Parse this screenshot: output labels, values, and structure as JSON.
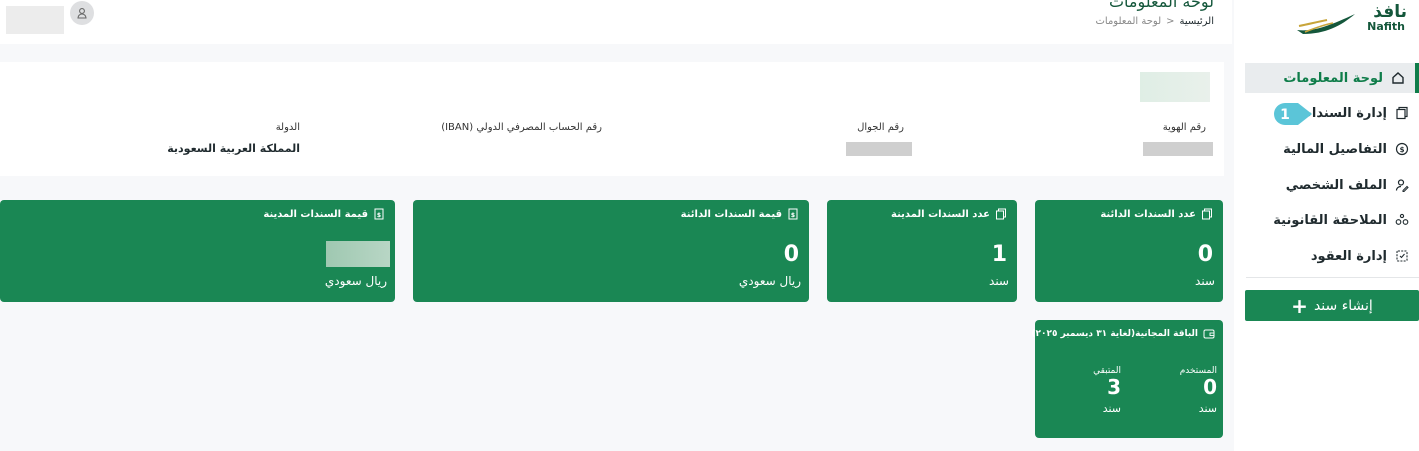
{
  "header": {
    "page_title": "لوحة المعلومات",
    "breadcrumb_home": "الرئيسية",
    "breadcrumb_sep": ">",
    "breadcrumb_current": "لوحة المعلومات"
  },
  "logo": {
    "arabic": "نافذ",
    "latin": "Nafith"
  },
  "sidebar": {
    "items": [
      {
        "label": "لوحة المعلومات",
        "icon": "home-icon"
      },
      {
        "label": "إدارة السندات",
        "icon": "documents-icon"
      },
      {
        "label": "التفاصيل المالية",
        "icon": "currency-icon"
      },
      {
        "label": "الملف الشخصي",
        "icon": "user-edit-icon"
      },
      {
        "label": "الملاحقة القانونية",
        "icon": "legal-icon"
      },
      {
        "label": "إدارة العقود",
        "icon": "contract-icon"
      }
    ],
    "badge": "1",
    "create_label": "إنشاء سند"
  },
  "info": {
    "id_label": "رقم الهوية",
    "mobile_label": "رقم الجوال",
    "iban_label": "رقم الحساب المصرفي الدولي (IBAN)",
    "country_label": "الدولة",
    "country_value": "المملكة العربية السعودية"
  },
  "cards": [
    {
      "title": "عدد السندات الدائنة",
      "value": "0",
      "unit": "سند",
      "icon": "documents-icon"
    },
    {
      "title": "عدد السندات المدينة",
      "value": "1",
      "unit": "سند",
      "icon": "documents-icon"
    },
    {
      "title": "قيمة السندات الدائنة",
      "value": "0",
      "unit": "ريال سعودي",
      "icon": "money-doc-icon"
    },
    {
      "title": "قيمة السندات المدينة",
      "value": "",
      "unit": "ريال سعودي",
      "icon": "money-doc-icon"
    }
  ],
  "package": {
    "title": "الباقة المجانية(لغاية ٣١ ديسمبر ٢٠٢٥)",
    "used_label": "المستخدم",
    "used_value": "0",
    "used_unit": "سند",
    "remaining_label": "المتبقي",
    "remaining_value": "3",
    "remaining_unit": "سند"
  },
  "colors": {
    "primary": "#1a8754",
    "dark_green": "#14573b",
    "active_bg": "#e9ecee"
  }
}
